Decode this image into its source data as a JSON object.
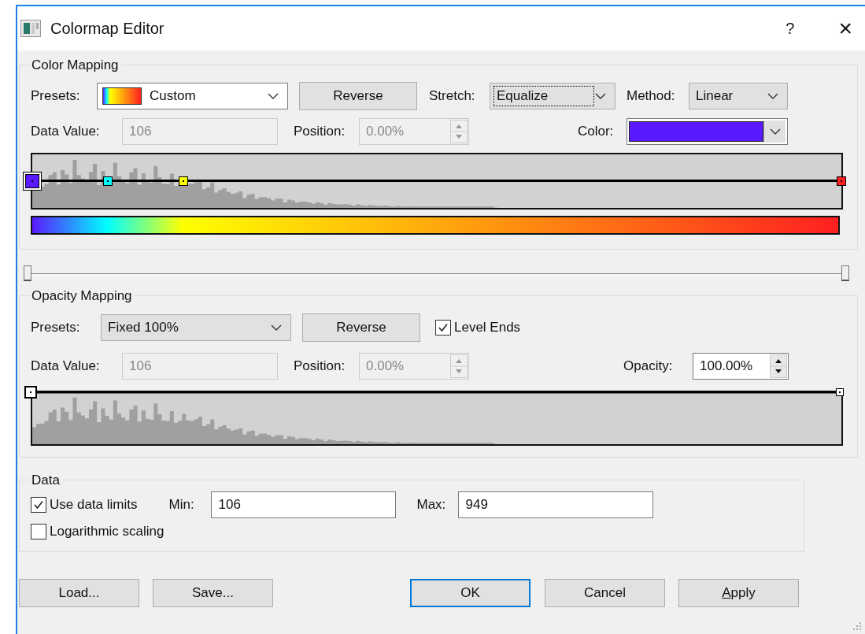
{
  "window": {
    "title": "Colormap Editor",
    "help": "?",
    "close": "×"
  },
  "color_mapping": {
    "title": "Color Mapping",
    "presets": {
      "label": "Presets:",
      "value": "Custom"
    },
    "reverse": "Reverse",
    "stretch": {
      "label": "Stretch:",
      "value": "Equalize",
      "focused": true
    },
    "method": {
      "label": "Method:",
      "value": "Linear",
      "focused": false
    },
    "data_value": {
      "label": "Data Value:",
      "value": "106",
      "disabled": true
    },
    "position": {
      "label": "Position:",
      "value": "0.00%",
      "disabled": true
    },
    "color": {
      "label": "Color:",
      "color": "#5a1aff"
    },
    "stops": [
      {
        "color": "#5a1aff",
        "selected": true
      },
      {
        "color": "#00ffff",
        "selected": false
      },
      {
        "color": "#ffff00",
        "selected": false
      },
      {
        "color": "#ff2020",
        "selected": false
      }
    ]
  },
  "range_slider": {
    "handles": [
      {
        "level": 0
      },
      {
        "level": 1
      }
    ]
  },
  "opacity_mapping": {
    "title": "Opacity Mapping",
    "presets": {
      "label": "Presets:",
      "value": "Fixed 100%"
    },
    "reverse": "Reverse",
    "level_ends": {
      "label": "Level Ends",
      "checked": true
    },
    "data_value": {
      "label": "Data Value:",
      "value": "106",
      "disabled": true
    },
    "position": {
      "label": "Position:",
      "value": "0.00%",
      "disabled": true
    },
    "opacity": {
      "label": "Opacity:",
      "value": "100.00%",
      "disabled": false
    },
    "points": [
      {
        "level": 0,
        "selected": true
      },
      {
        "level": 1,
        "selected": false
      }
    ]
  },
  "data": {
    "title": "Data",
    "use_data_limits": {
      "label": "Use data limits",
      "checked": true
    },
    "min": {
      "label": "Min:",
      "value": "106"
    },
    "max": {
      "label": "Max:",
      "value": "949"
    },
    "logarithmic_scaling": {
      "label": "Logarithmic scaling",
      "checked": false
    }
  },
  "buttons": [
    {
      "label": "Load...",
      "default": false,
      "mnemonic": false
    },
    {
      "label": "Save...",
      "default": false,
      "mnemonic": false
    },
    {
      "label": "OK",
      "default": true,
      "mnemonic": false
    },
    {
      "label": "Cancel",
      "default": false,
      "mnemonic": false
    },
    {
      "label": "Apply",
      "default": false,
      "mnemonic": true
    }
  ]
}
